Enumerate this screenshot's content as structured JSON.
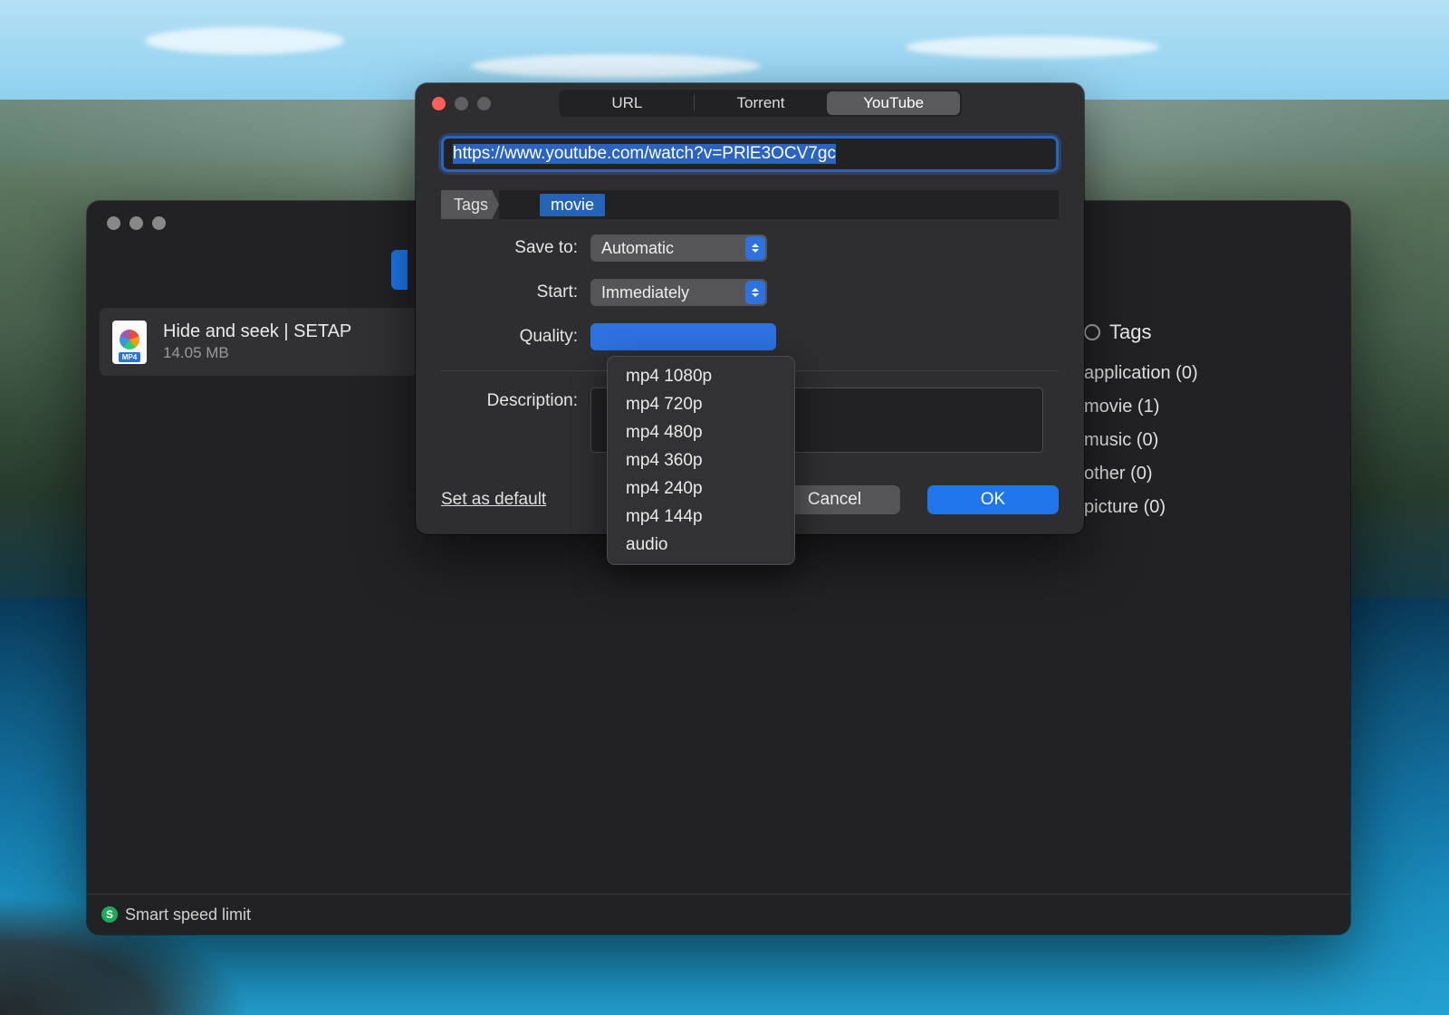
{
  "main_window": {
    "download": {
      "title": "Hide and seek | SETAP",
      "size": "14.05 MB",
      "file_type": "MP4"
    },
    "sidebar": {
      "header": "Tags",
      "tags": [
        "application (0)",
        "movie (1)",
        "music (0)",
        "other (0)",
        "picture (0)"
      ]
    },
    "status": "Smart speed limit",
    "status_badge": "S"
  },
  "dialog": {
    "tabs": [
      "URL",
      "Torrent",
      "YouTube"
    ],
    "active_tab": "YouTube",
    "url_value": "https://www.youtube.com/watch?v=PRlE3OCV7gc",
    "tags_label": "Tags",
    "tag_value": "movie",
    "labels": {
      "save_to": "Save to:",
      "start": "Start:",
      "quality": "Quality:",
      "description": "Description:"
    },
    "save_to_value": "Automatic",
    "start_value": "Immediately",
    "quality_options": [
      "mp4 1080p",
      "mp4 720p",
      "mp4 480p",
      "mp4 360p",
      "mp4 240p",
      "mp4 144p",
      "audio"
    ],
    "set_default": "Set as default",
    "cancel": "Cancel",
    "ok": "OK"
  }
}
